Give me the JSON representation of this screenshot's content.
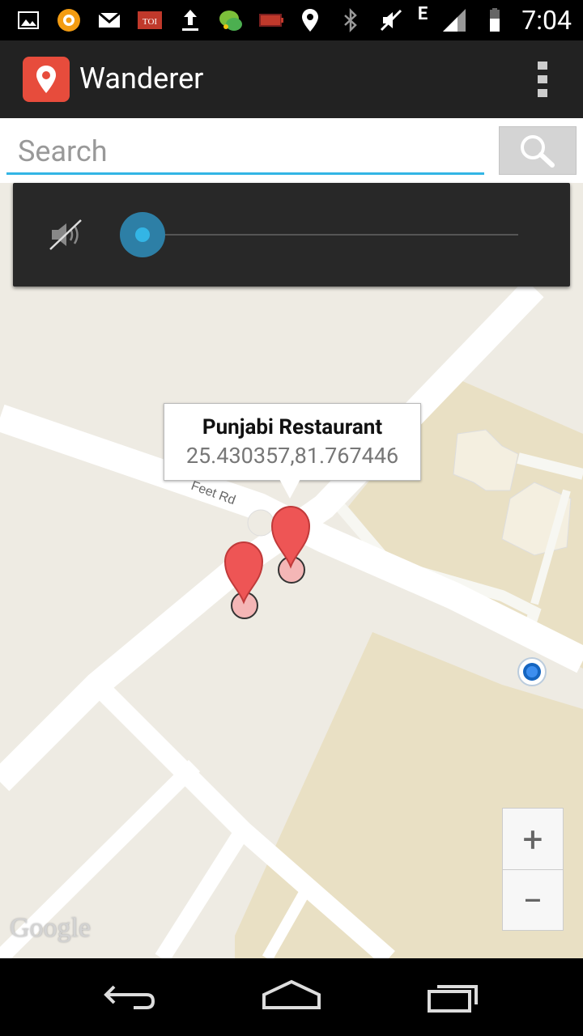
{
  "status_bar": {
    "network_type": "E",
    "time": "7:04",
    "left_icons": [
      "gallery-icon",
      "audible-icon",
      "gmail-icon",
      "toi-icon",
      "upload-icon",
      "chat-icon",
      "battery-alert-icon"
    ],
    "right_icons": [
      "location-icon",
      "bluetooth-icon",
      "mute-icon",
      "signal-icon",
      "battery-icon"
    ]
  },
  "app_bar": {
    "title": "Wanderer",
    "icon": "map-pin-icon",
    "menu_icon": "overflow-menu-icon"
  },
  "search": {
    "placeholder": "Search",
    "value": "",
    "button_icon": "search-icon"
  },
  "volume": {
    "icon": "speaker-muted-icon",
    "level": 0
  },
  "map": {
    "road_label": "Feet Rd",
    "info_window": {
      "title": "Punjabi Restaurant",
      "coordinates": "25.430357,81.767446"
    },
    "markers": [
      "marker-1",
      "marker-2"
    ],
    "attribution": "Google"
  },
  "zoom": {
    "in_label": "+",
    "out_label": "−"
  },
  "nav_bar": {
    "icons": [
      "back-icon",
      "home-icon",
      "recents-icon"
    ]
  },
  "colors": {
    "accent": "#33b5e5",
    "app_icon": "#e74c3c",
    "marker": "#ee5555",
    "map_bg": "#eeebe3",
    "road": "#ffffff",
    "park": "#e9e0c4"
  }
}
